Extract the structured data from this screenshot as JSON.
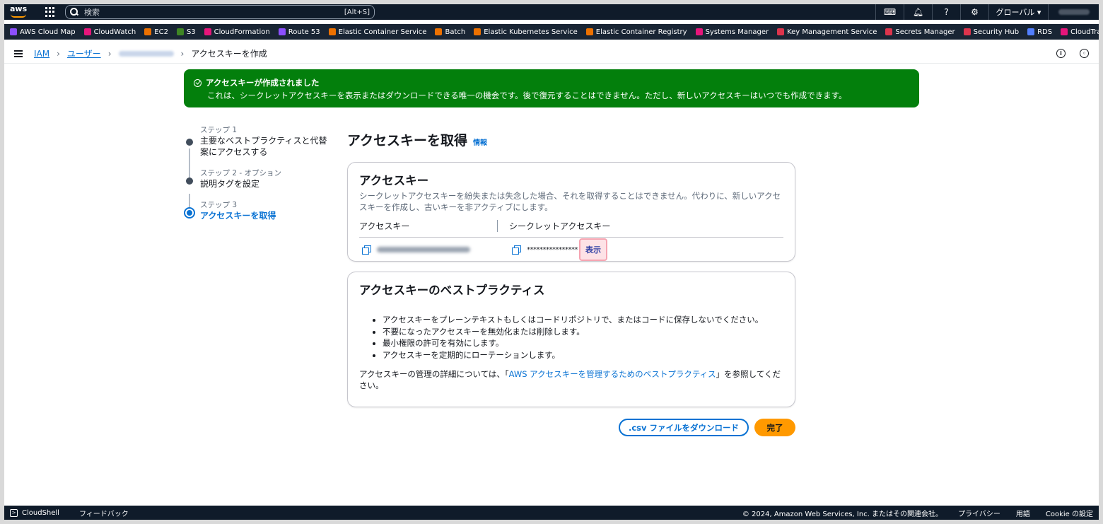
{
  "topnav": {
    "search_placeholder": "検索",
    "search_shortcut": "[Alt+S]",
    "region": "グローバル ▾"
  },
  "favorites": [
    {
      "label": "AWS Cloud Map",
      "color": "#8c4fff"
    },
    {
      "label": "CloudWatch",
      "color": "#e7157b"
    },
    {
      "label": "EC2",
      "color": "#ed7100"
    },
    {
      "label": "S3",
      "color": "#3f8624"
    },
    {
      "label": "CloudFormation",
      "color": "#e7157b"
    },
    {
      "label": "Route 53",
      "color": "#8c4fff"
    },
    {
      "label": "Elastic Container Service",
      "color": "#ed7100"
    },
    {
      "label": "Batch",
      "color": "#ed7100"
    },
    {
      "label": "Elastic Kubernetes Service",
      "color": "#ed7100"
    },
    {
      "label": "Elastic Container Registry",
      "color": "#ed7100"
    },
    {
      "label": "Systems Manager",
      "color": "#e7157b"
    },
    {
      "label": "Key Management Service",
      "color": "#dd344c"
    },
    {
      "label": "Secrets Manager",
      "color": "#dd344c"
    },
    {
      "label": "Security Hub",
      "color": "#dd344c"
    },
    {
      "label": "RDS",
      "color": "#527fff"
    },
    {
      "label": "CloudTrail",
      "color": "#e7157b"
    }
  ],
  "breadcrumb": {
    "iam": "IAM",
    "users": "ユーザー",
    "current": "アクセスキーを作成"
  },
  "flash": {
    "title": "アクセスキーが作成されました",
    "message": "これは、シークレットアクセスキーを表示またはダウンロードできる唯一の機会です。後で復元することはできません。ただし、新しいアクセスキーはいつでも作成できます。"
  },
  "steps": [
    {
      "label": "ステップ 1",
      "title": "主要なベストプラクティスと代替案にアクセスする"
    },
    {
      "label": "ステップ 2 - オプション",
      "title": "説明タグを設定"
    },
    {
      "label": "ステップ 3",
      "title": "アクセスキーを取得"
    }
  ],
  "page": {
    "title": "アクセスキーを取得",
    "info": "情報"
  },
  "access_key_card": {
    "title": "アクセスキー",
    "description": "シークレットアクセスキーを紛失または失念した場合、それを取得することはできません。代わりに、新しいアクセスキーを作成し、古いキーを非アクティブにします。",
    "col_access_key": "アクセスキー",
    "col_secret": "シークレットアクセスキー",
    "secret_masked": "****************",
    "show_label": "表示"
  },
  "best_practices": {
    "title": "アクセスキーのベストプラクティス",
    "items": [
      "アクセスキーをプレーンテキストもしくはコードリポジトリで、またはコードに保存しないでください。",
      "不要になったアクセスキーを無効化または削除します。",
      "最小権限の許可を有効にします。",
      "アクセスキーを定期的にローテーションします。"
    ],
    "footer_prefix": "アクセスキーの管理の詳細については、「",
    "footer_link": "AWS アクセスキーを管理するためのベストプラクティス",
    "footer_suffix": "」を参照してください。"
  },
  "actions": {
    "download": ".csv ファイルをダウンロード",
    "done": "完了"
  },
  "footer": {
    "cloudshell": "CloudShell",
    "feedback": "フィードバック",
    "copyright": "© 2024, Amazon Web Services, Inc. またはその関連会社。",
    "privacy": "プライバシー",
    "terms": "用語",
    "cookie": "Cookie の設定"
  }
}
